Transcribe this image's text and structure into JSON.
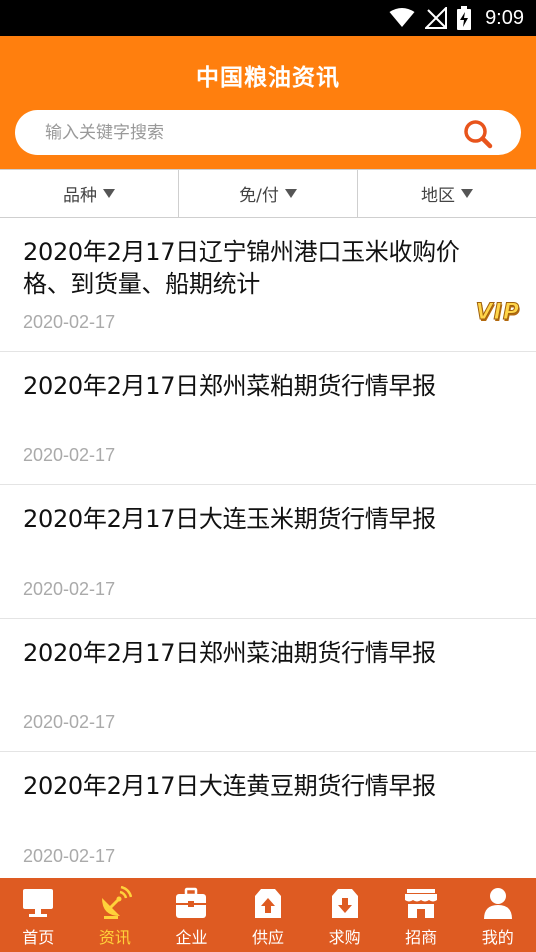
{
  "status_bar": {
    "time": "9:09"
  },
  "header": {
    "title": "中国粮油资讯",
    "search_placeholder": "输入关键字搜索"
  },
  "filters": [
    {
      "label": "品种"
    },
    {
      "label": "免/付"
    },
    {
      "label": "地区"
    }
  ],
  "news": [
    {
      "title": "2020年2月17日辽宁锦州港口玉米收购价格、到货量、船期统计",
      "date": "2020-02-17",
      "badge": "VIP"
    },
    {
      "title": "2020年2月17日郑州菜粕期货行情早报",
      "date": "2020-02-17"
    },
    {
      "title": "2020年2月17日大连玉米期货行情早报",
      "date": "2020-02-17"
    },
    {
      "title": "2020年2月17日郑州菜油期货行情早报",
      "date": "2020-02-17"
    },
    {
      "title": "2020年2月17日大连黄豆期货行情早报",
      "date": "2020-02-17"
    }
  ],
  "bottom_nav": [
    {
      "label": "首页",
      "icon": "monitor-icon"
    },
    {
      "label": "资讯",
      "icon": "satellite-dish-icon",
      "active": true
    },
    {
      "label": "企业",
      "icon": "briefcase-icon"
    },
    {
      "label": "供应",
      "icon": "upload-box-icon"
    },
    {
      "label": "求购",
      "icon": "download-box-icon"
    },
    {
      "label": "招商",
      "icon": "storefront-icon"
    },
    {
      "label": "我的",
      "icon": "user-icon"
    }
  ],
  "colors": {
    "brand": "#ff7f0e",
    "nav": "#de5b22",
    "active": "#ffd23a",
    "search_icon": "#e8541c"
  }
}
